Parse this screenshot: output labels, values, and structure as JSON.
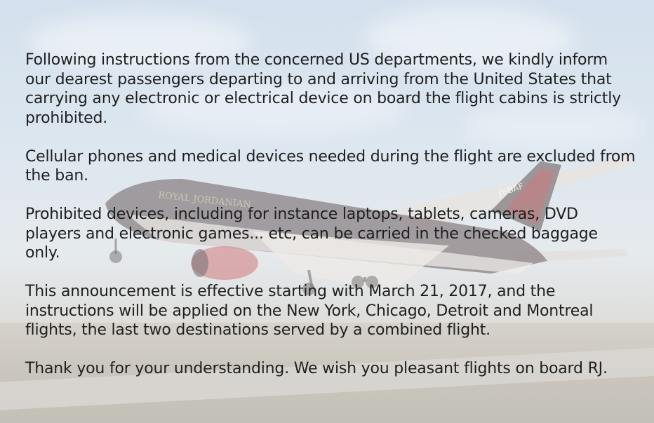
{
  "announcement": {
    "paragraphs": [
      "Following instructions from the concerned US departments, we kindly inform our dearest passengers departing to and arriving from the United States that carrying any electronic or electrical device on board the flight cabins is strictly prohibited.",
      "Cellular phones and medical devices needed during the flight are excluded from the ban.",
      "Prohibited devices, including for instance laptops, tablets, cameras, DVD players and electronic games... etc, can be carried in the checked baggage only.",
      "This announcement is effective starting with March 21, 2017, and the instructions will be applied on the New York, Chicago, Detroit and Montreal flights, the last two destinations served by a combined flight.",
      "Thank you for your understanding. We wish you pleasant flights on board RJ."
    ]
  },
  "background": {
    "fuselage_lettering": "ROYAL JORDANIAN",
    "tail_registration": "JY-BAF",
    "colors": {
      "sky_top": "#b9cde2",
      "fuselage": "#3a2a2e",
      "accent_red": "#b3262c",
      "text": "#1f1f1f"
    }
  }
}
